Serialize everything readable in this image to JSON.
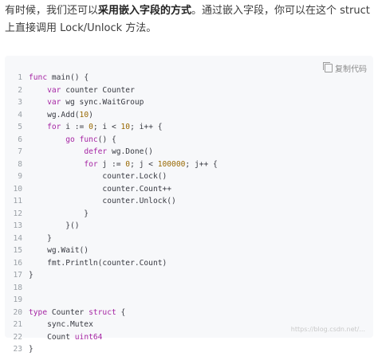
{
  "intro": {
    "part1": "有时候，我们还可以",
    "bold": "采用嵌入字段的方式",
    "part2": "。通过嵌入字段，你可以在这个 struct 上直接调用 Lock/Unlock 方法。"
  },
  "copy_button": {
    "label": "复制代码"
  },
  "watermark": "https://blog.csdn.net/...",
  "code": {
    "language": "go",
    "line_numbers": [
      "1",
      "2",
      "3",
      "4",
      "5",
      "6",
      "7",
      "8",
      "9",
      "10",
      "11",
      "12",
      "13",
      "14",
      "15",
      "16",
      "17",
      "18",
      "19",
      "20",
      "21",
      "22",
      "23"
    ],
    "lines": [
      [
        {
          "t": "func",
          "c": "kw"
        },
        {
          "t": " main() {",
          "c": "src"
        }
      ],
      [
        {
          "t": "    ",
          "c": "src"
        },
        {
          "t": "var",
          "c": "kw"
        },
        {
          "t": " counter Counter",
          "c": "src"
        }
      ],
      [
        {
          "t": "    ",
          "c": "src"
        },
        {
          "t": "var",
          "c": "kw"
        },
        {
          "t": " wg sync.WaitGroup",
          "c": "src"
        }
      ],
      [
        {
          "t": "    wg.Add(",
          "c": "src"
        },
        {
          "t": "10",
          "c": "num"
        },
        {
          "t": ")",
          "c": "src"
        }
      ],
      [
        {
          "t": "    ",
          "c": "src"
        },
        {
          "t": "for",
          "c": "kw"
        },
        {
          "t": " i := ",
          "c": "src"
        },
        {
          "t": "0",
          "c": "num"
        },
        {
          "t": "; i < ",
          "c": "src"
        },
        {
          "t": "10",
          "c": "num"
        },
        {
          "t": "; i++ {",
          "c": "src"
        }
      ],
      [
        {
          "t": "        ",
          "c": "src"
        },
        {
          "t": "go",
          "c": "kw"
        },
        {
          "t": " ",
          "c": "src"
        },
        {
          "t": "func",
          "c": "kw"
        },
        {
          "t": "() {",
          "c": "src"
        }
      ],
      [
        {
          "t": "            ",
          "c": "src"
        },
        {
          "t": "defer",
          "c": "kw"
        },
        {
          "t": " wg.Done()",
          "c": "src"
        }
      ],
      [
        {
          "t": "            ",
          "c": "src"
        },
        {
          "t": "for",
          "c": "kw"
        },
        {
          "t": " j := ",
          "c": "src"
        },
        {
          "t": "0",
          "c": "num"
        },
        {
          "t": "; j < ",
          "c": "src"
        },
        {
          "t": "100000",
          "c": "num"
        },
        {
          "t": "; j++ {",
          "c": "src"
        }
      ],
      [
        {
          "t": "                counter.Lock()",
          "c": "src"
        }
      ],
      [
        {
          "t": "                counter.Count++",
          "c": "src"
        }
      ],
      [
        {
          "t": "                counter.Unlock()",
          "c": "src"
        }
      ],
      [
        {
          "t": "            }",
          "c": "src"
        }
      ],
      [
        {
          "t": "        }()",
          "c": "src"
        }
      ],
      [
        {
          "t": "    }",
          "c": "src"
        }
      ],
      [
        {
          "t": "    wg.Wait()",
          "c": "src"
        }
      ],
      [
        {
          "t": "    fmt.Println(counter.Count)",
          "c": "src"
        }
      ],
      [
        {
          "t": "}",
          "c": "src"
        }
      ],
      [
        {
          "t": "",
          "c": "src"
        }
      ],
      [
        {
          "t": "",
          "c": "src"
        }
      ],
      [
        {
          "t": "type",
          "c": "kw"
        },
        {
          "t": " Counter ",
          "c": "src"
        },
        {
          "t": "struct",
          "c": "kw"
        },
        {
          "t": " {",
          "c": "src"
        }
      ],
      [
        {
          "t": "    sync.Mutex",
          "c": "src"
        }
      ],
      [
        {
          "t": "    Count ",
          "c": "src"
        },
        {
          "t": "uint64",
          "c": "kw"
        }
      ],
      [
        {
          "t": "}",
          "c": "src"
        }
      ]
    ]
  }
}
